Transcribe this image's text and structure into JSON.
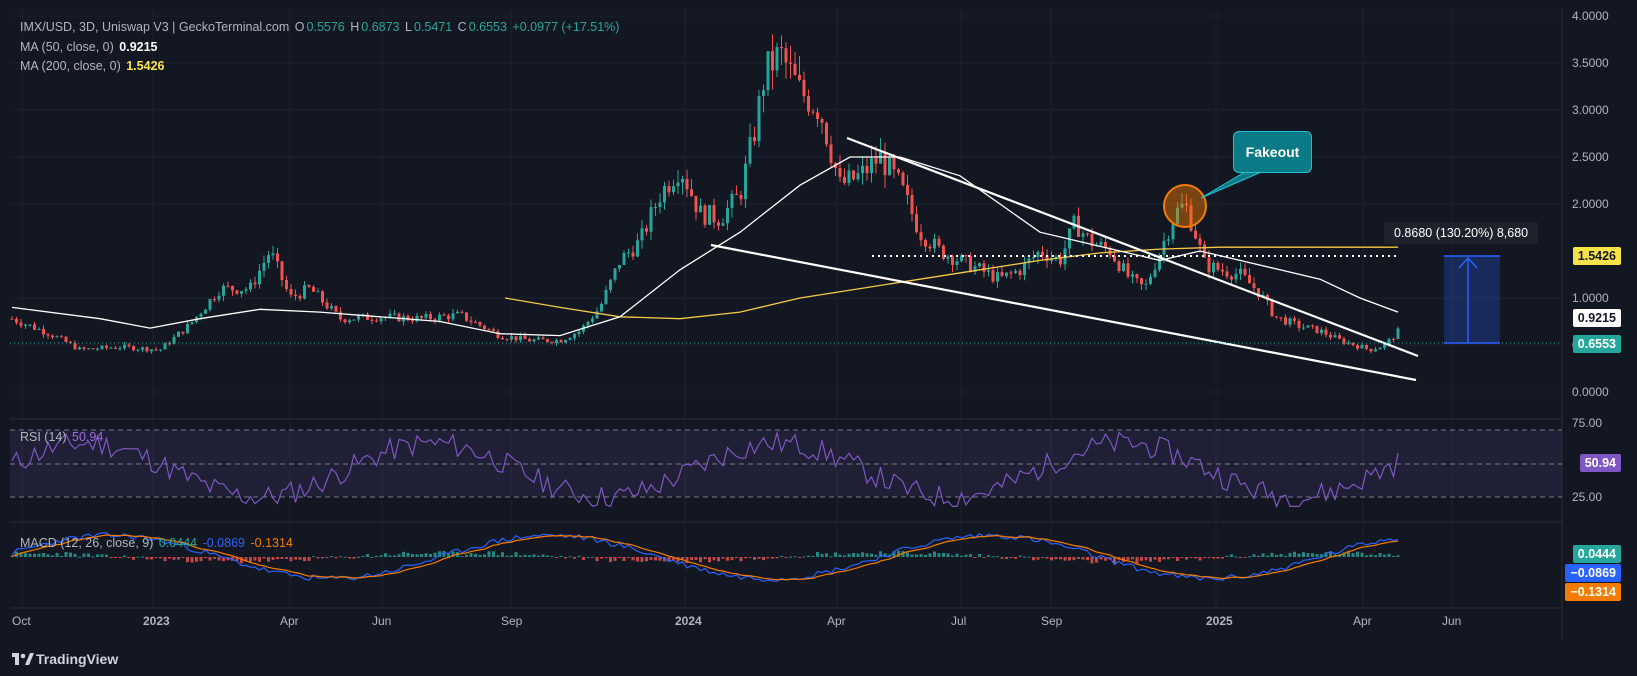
{
  "header": {
    "symbol_line": "IMX/USD, 3D, Uniswap V3 | GeckoTerminal.com",
    "o_label": "O",
    "o_value": "0.5576",
    "h_label": "H",
    "h_value": "0.6873",
    "l_label": "L",
    "l_value": "0.5471",
    "c_label": "C",
    "c_value": "0.6553",
    "change": "+0.0977 (+17.51%)"
  },
  "indicators": {
    "ma50_label": "MA (50, close, 0)",
    "ma50_value": "0.9215",
    "ma200_label": "MA (200, close, 0)",
    "ma200_value": "1.5426",
    "rsi_label": "RSI (14)",
    "rsi_value": "50.94",
    "macd_label": "MACD (12, 26, close, 9)",
    "macd_hist": "0.0444",
    "macd_line": "-0.0869",
    "macd_signal": "-0.1314"
  },
  "price_axis": [
    "4.0000",
    "3.5000",
    "3.0000",
    "2.5000",
    "2.0000",
    "1.0000",
    "0.5000",
    "0.0000"
  ],
  "price_tags": {
    "ma200": "1.5426",
    "ma50": "0.9215",
    "close": "0.6553"
  },
  "rsi_axis": [
    "75.00",
    "25.00"
  ],
  "rsi_tag": "50.94",
  "macd_tags": {
    "hist": "0.0444",
    "macd": "−0.0869",
    "signal": "−0.1314"
  },
  "time_axis": [
    "Oct",
    "2023",
    "Apr",
    "Jun",
    "Sep",
    "2024",
    "Apr",
    "Jul",
    "Sep",
    "2025",
    "Apr",
    "Jun"
  ],
  "annotations": {
    "fakeout": "Fakeout",
    "measure": "0.8680 (130.20%) 8,680"
  },
  "brand": "TradingView",
  "colors": {
    "bg": "#131722",
    "up": "#26a69a",
    "down": "#ef5350",
    "ma50": "#ffffff",
    "ma200": "#f7c948",
    "rsi": "#7e57c2",
    "macd": "#2962ff",
    "signal": "#f57c00",
    "accent_tag_close": "#26a69a"
  },
  "chart_data": {
    "type": "line",
    "title": "IMX/USD, 3D, Uniswap V3",
    "x": [
      "2022-10",
      "2023-01",
      "2023-04",
      "2023-06",
      "2023-09",
      "2024-01",
      "2024-04",
      "2024-07",
      "2024-09",
      "2025-01",
      "2025-04"
    ],
    "series": [
      {
        "name": "MA (50, close, 0)",
        "values": [
          0.88,
          0.65,
          0.72,
          0.8,
          0.6,
          0.95,
          2.55,
          1.8,
          1.45,
          1.4,
          0.95
        ]
      },
      {
        "name": "MA (200, close, 0)",
        "values": [
          null,
          null,
          null,
          null,
          1.05,
          0.95,
          1.15,
          1.35,
          1.5,
          1.54,
          1.54
        ]
      }
    ],
    "ylim": [
      0,
      4.0
    ],
    "last": {
      "open": 0.5576,
      "high": 0.6873,
      "low": 0.5471,
      "close": 0.6553
    }
  }
}
